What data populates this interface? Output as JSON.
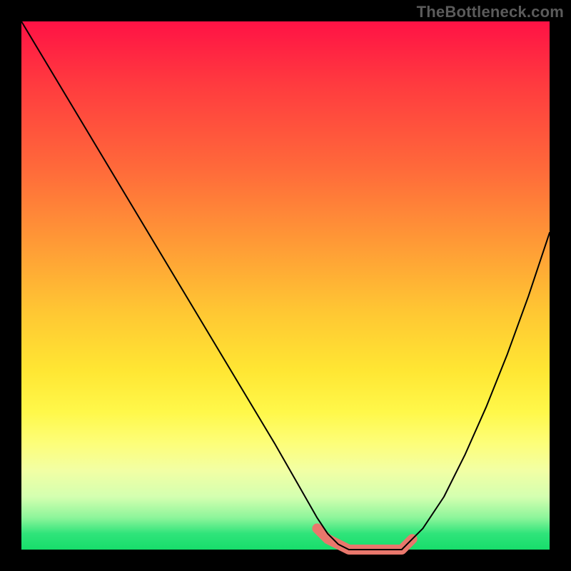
{
  "watermark": "TheBottleneck.com",
  "colors": {
    "frame_bg": "#000000",
    "curve": "#000000",
    "highlight": "#e9776c"
  },
  "chart_data": {
    "type": "line",
    "title": "",
    "xlabel": "",
    "ylabel": "",
    "xlim": [
      0,
      100
    ],
    "ylim": [
      0,
      100
    ],
    "grid": false,
    "series": [
      {
        "name": "Left descending curve",
        "x": [
          0,
          6,
          12,
          18,
          24,
          30,
          36,
          42,
          48,
          52,
          56,
          58,
          60,
          62
        ],
        "values": [
          100,
          90,
          80,
          70,
          60,
          50,
          40,
          30,
          20,
          13,
          6,
          3,
          1,
          0
        ]
      },
      {
        "name": "Valley floor",
        "x": [
          62,
          66,
          70,
          72
        ],
        "values": [
          0,
          0,
          0,
          0
        ]
      },
      {
        "name": "Right ascending curve",
        "x": [
          72,
          76,
          80,
          84,
          88,
          92,
          96,
          100
        ],
        "values": [
          0,
          4,
          10,
          18,
          27,
          37,
          48,
          60
        ]
      }
    ],
    "annotations": [
      {
        "name": "Highlighted optimum range",
        "x": [
          56,
          58,
          60,
          62,
          66,
          70,
          72,
          74
        ],
        "values": [
          4,
          2,
          1,
          0,
          0,
          0,
          0,
          2
        ],
        "color": "#e9776c"
      }
    ]
  }
}
